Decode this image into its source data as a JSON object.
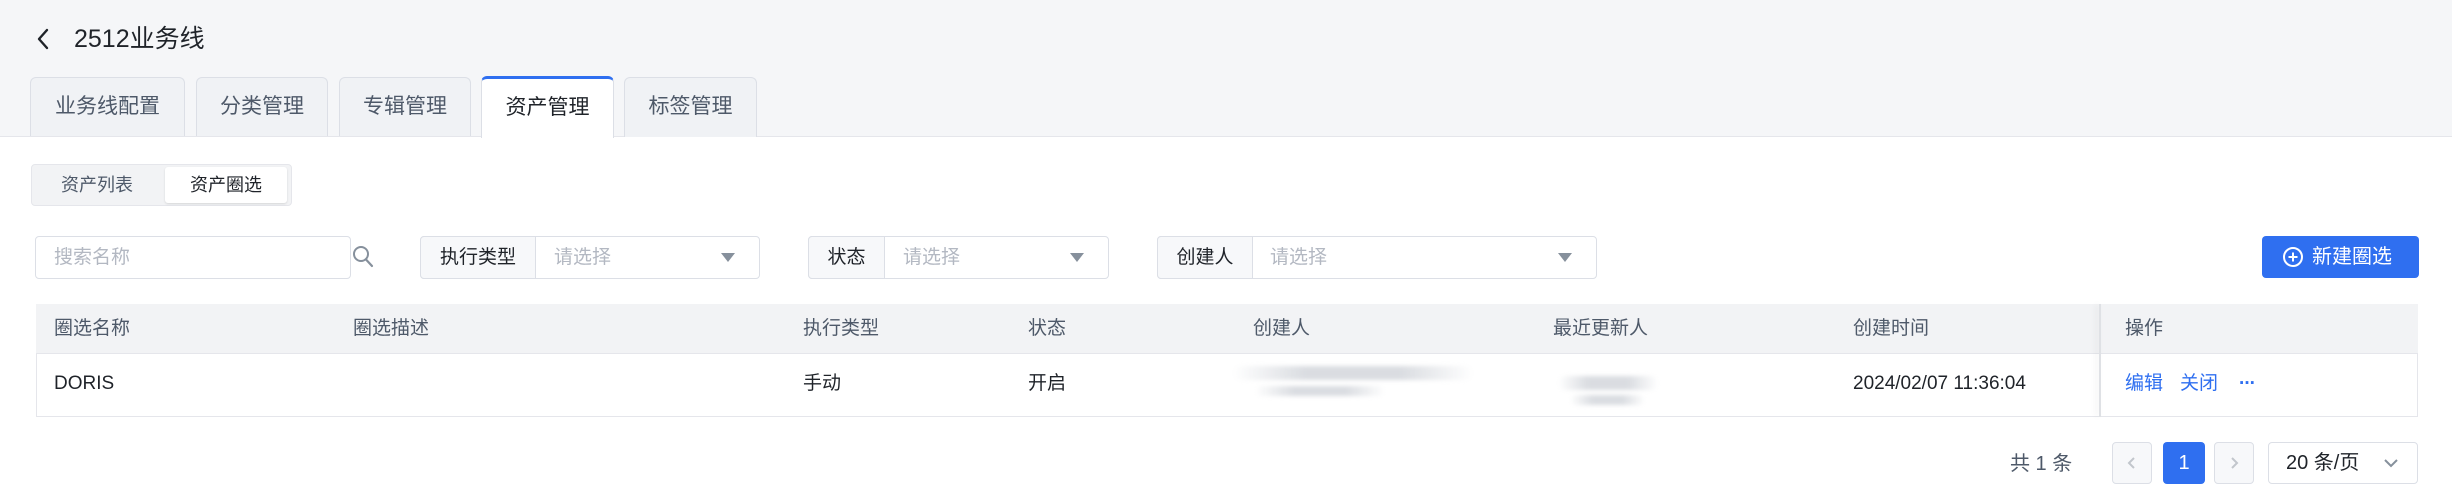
{
  "header": {
    "title": "2512业务线"
  },
  "tabs": [
    {
      "label": "业务线配置"
    },
    {
      "label": "分类管理"
    },
    {
      "label": "专辑管理"
    },
    {
      "label": "资产管理",
      "active": true
    },
    {
      "label": "标签管理"
    }
  ],
  "segment": {
    "items": [
      {
        "label": "资产列表"
      },
      {
        "label": "资产圈选",
        "active": true
      }
    ]
  },
  "filters": {
    "search_placeholder": "搜索名称",
    "exec_type": {
      "label": "执行类型",
      "placeholder": "请选择"
    },
    "status": {
      "label": "状态",
      "placeholder": "请选择"
    },
    "creator": {
      "label": "创建人",
      "placeholder": "请选择"
    }
  },
  "actions": {
    "new_label": "新建圈选"
  },
  "table": {
    "columns": [
      "圈选名称",
      "圈选描述",
      "执行类型",
      "状态",
      "创建人",
      "最近更新人",
      "创建时间",
      "操作"
    ],
    "rows": [
      {
        "name": "DORIS",
        "desc": "",
        "exec_type": "手动",
        "status": "开启",
        "created_at": "2024/02/07 11:36:04",
        "op_edit": "编辑",
        "op_close": "关闭",
        "op_more": "···"
      }
    ]
  },
  "pagination": {
    "total": "共 1 条",
    "current": "1",
    "page_size": "20 条/页"
  },
  "colors": {
    "primary": "#2f6ff0",
    "background": "#f5f6f8",
    "border": "#dcdfe6"
  }
}
